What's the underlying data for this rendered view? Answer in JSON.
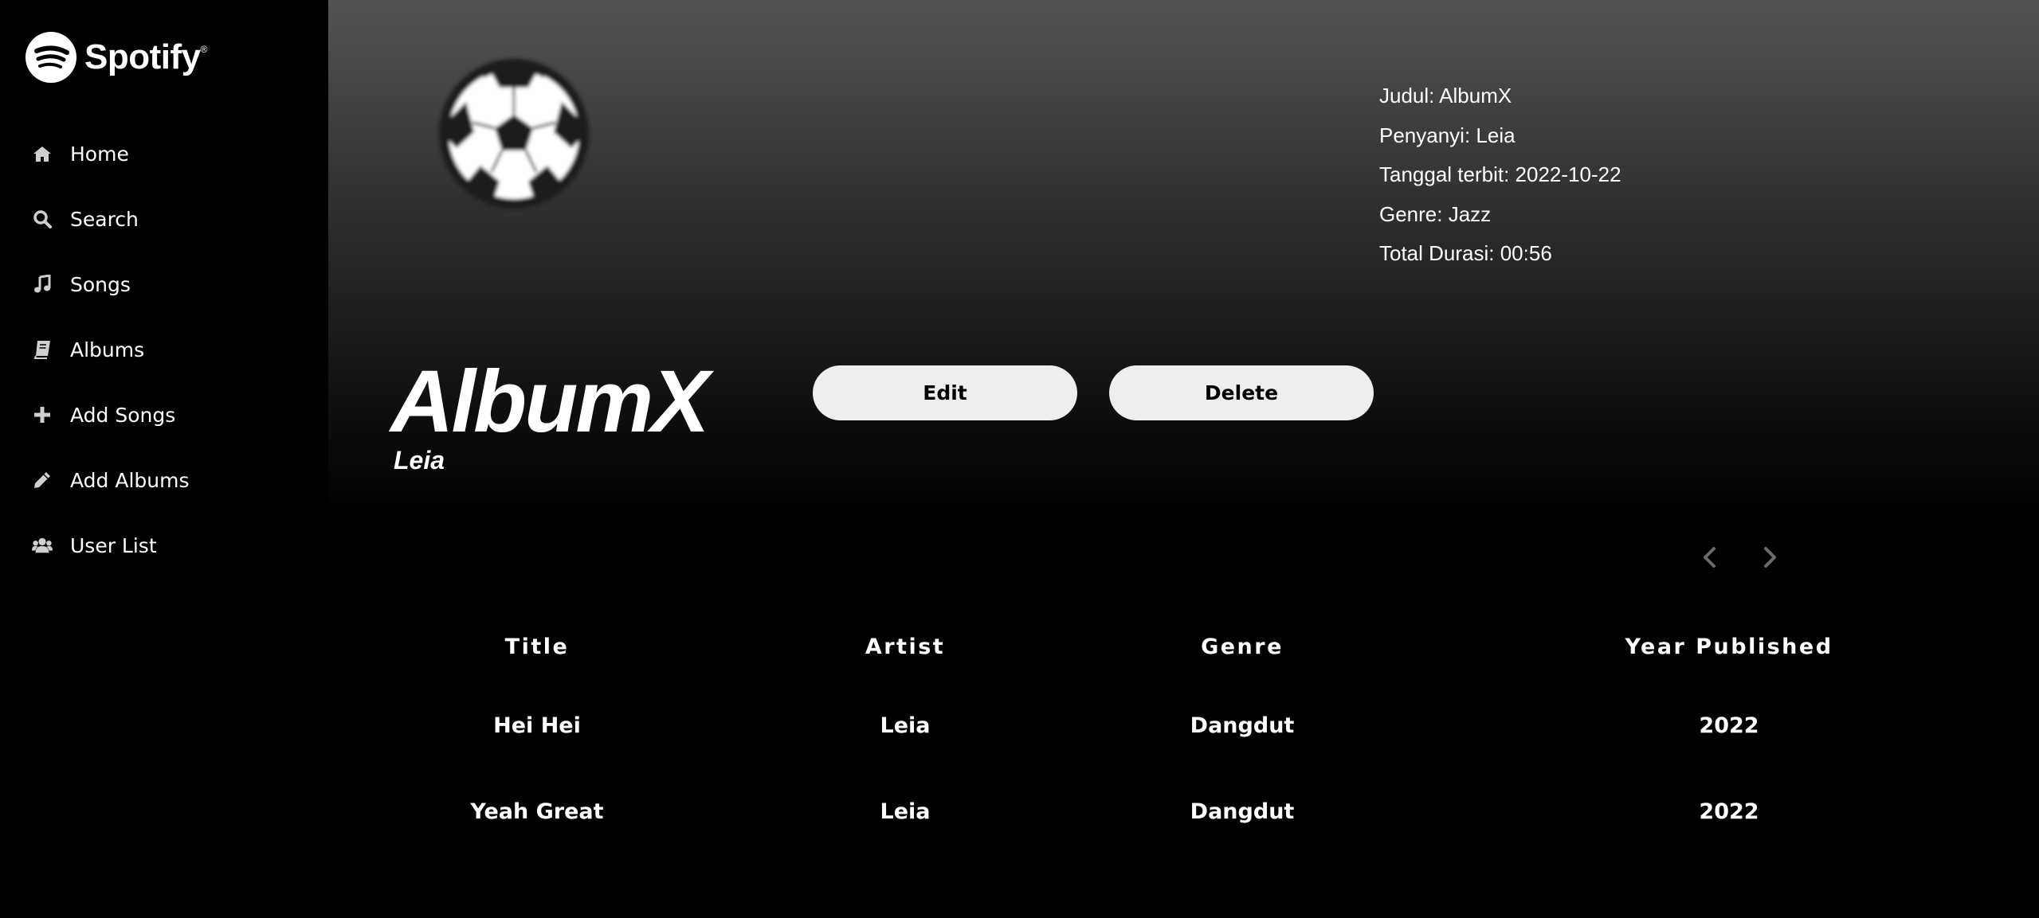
{
  "brand": {
    "name": "Spotify",
    "mark": "®"
  },
  "sidebar": {
    "items": [
      {
        "label": "Home",
        "icon": "home-icon"
      },
      {
        "label": "Search",
        "icon": "search-icon"
      },
      {
        "label": "Songs",
        "icon": "music-note-icon"
      },
      {
        "label": "Albums",
        "icon": "book-icon"
      },
      {
        "label": "Add Songs",
        "icon": "plus-icon"
      },
      {
        "label": "Add Albums",
        "icon": "pencil-icon"
      },
      {
        "label": "User List",
        "icon": "users-icon"
      }
    ]
  },
  "album": {
    "title": "AlbumX",
    "artist": "Leia",
    "cover_icon": "soccer-ball-icon",
    "info": {
      "judul": "Judul: AlbumX",
      "penyanyi": "Penyanyi: Leia",
      "tanggal": "Tanggal terbit: 2022-10-22",
      "genre": "Genre: Jazz",
      "durasi": "Total Durasi: 00:56"
    }
  },
  "actions": {
    "edit_label": "Edit",
    "delete_label": "Delete"
  },
  "pagination": {
    "prev_icon": "chevron-left-icon",
    "next_icon": "chevron-right-icon"
  },
  "table": {
    "headers": [
      "Title",
      "Artist",
      "Genre",
      "Year Published"
    ],
    "rows": [
      [
        "Hei Hei",
        "Leia",
        "Dangdut",
        "2022"
      ],
      [
        "Yeah Great",
        "Leia",
        "Dangdut",
        "2022"
      ]
    ]
  },
  "colors": {
    "sidebar_bg": "#000000",
    "button_bg": "#eeeeee",
    "gradient_top": "#535353"
  }
}
